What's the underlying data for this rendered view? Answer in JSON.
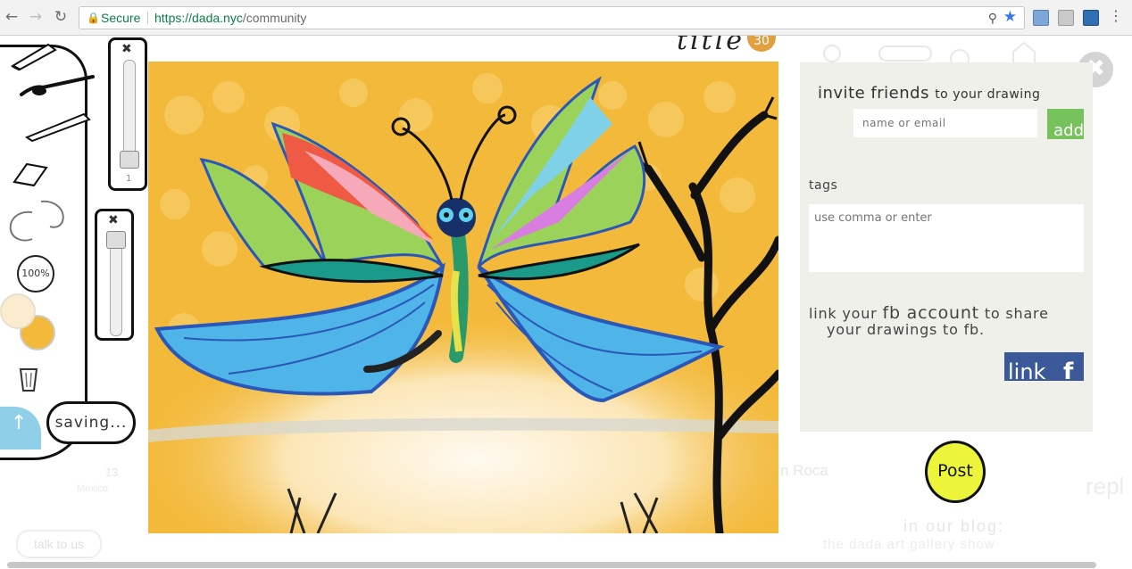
{
  "browser": {
    "secure_label": "Secure",
    "url_host": "https://dada.nyc",
    "url_path": "/community",
    "icons": [
      "back-icon",
      "forward-icon",
      "reload-icon",
      "lock-icon",
      "zoom-icon",
      "star-icon",
      "more-icon"
    ]
  },
  "toolbar": {
    "zoom_level": "100%",
    "brush_size_value": "1",
    "primary_color": "#fbeccf",
    "secondary_color": "#f3b93a",
    "status": "saving...",
    "icons": [
      "pencil-icon",
      "brush-icon",
      "pen-icon",
      "eraser-icon",
      "undo-icon",
      "redo-icon",
      "trash-icon"
    ]
  },
  "drawing": {
    "title": "title",
    "count": "30"
  },
  "share_panel": {
    "invite_title": "invite friends",
    "invite_subtitle": "to your drawing",
    "invite_placeholder": "name or email",
    "add_label": "add",
    "tags_label": "tags",
    "tags_placeholder": "use comma or enter",
    "fb_text_a": "link your",
    "fb_text_b": "fb account",
    "fb_text_c": "to share",
    "fb_text_d": "your drawings to fb.",
    "link_label": "link",
    "fb_icon": "f"
  },
  "post_label": "Post",
  "background": {
    "blog_heading": "in our blog:",
    "blog_link": "the dada art gallery show",
    "talk_label": "talk to us",
    "like_count": "13",
    "location": "Mexico",
    "artist": "n Roca",
    "reply": "repl"
  },
  "colors": {
    "canvas_bg": "#f3b93a",
    "panel_bg": "#eff0ea",
    "add_green": "#76c25c",
    "fb_blue": "#3b5998",
    "post_yellow": "#ecf53a",
    "badge_orange": "#e0a040"
  }
}
